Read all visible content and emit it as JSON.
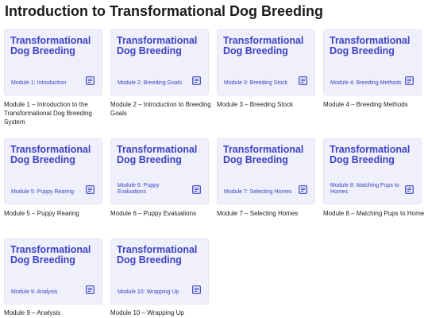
{
  "page": {
    "title": "Introduction to Transformational Dog Breeding"
  },
  "brand_title": "Transformational Dog Breeding",
  "modules": [
    {
      "label": "Module 1: Introduction",
      "caption": "Module 1 – Introduction to the Transformational Dog Breeding System"
    },
    {
      "label": "Module 2: Breeding Goals",
      "caption": "Module 2 – Introduction to Breeding Goals"
    },
    {
      "label": "Module 3: Breeding Stock",
      "caption": "Module 3 – Breeding Stock"
    },
    {
      "label": "Module 4: Breeding Methods",
      "caption": "Module 4 – Breeding Methods"
    },
    {
      "label": "Module 5: Puppy Rearing",
      "caption": "Module 5 – Puppy Rearing"
    },
    {
      "label": "Module 6: Puppy Evaluations",
      "caption": "Module 6 – Puppy Evaluations"
    },
    {
      "label": "Module 7: Selecting Homes",
      "caption": "Module 7 – Selecting Homes"
    },
    {
      "label": "Module 8: Matching Pups to Homes",
      "caption": "Module 8 – Matching Pups to Homes"
    },
    {
      "label": "Module 9: Analysis",
      "caption": "Module 9 – Analysis"
    },
    {
      "label": "Module 10: Wrapping Up",
      "caption": "Module 10 – Wrapping Up"
    }
  ],
  "colors": {
    "accent": "#3d42c4",
    "card_bg": "#eff0fb"
  },
  "icons": {
    "module_icon": "book-icon"
  }
}
